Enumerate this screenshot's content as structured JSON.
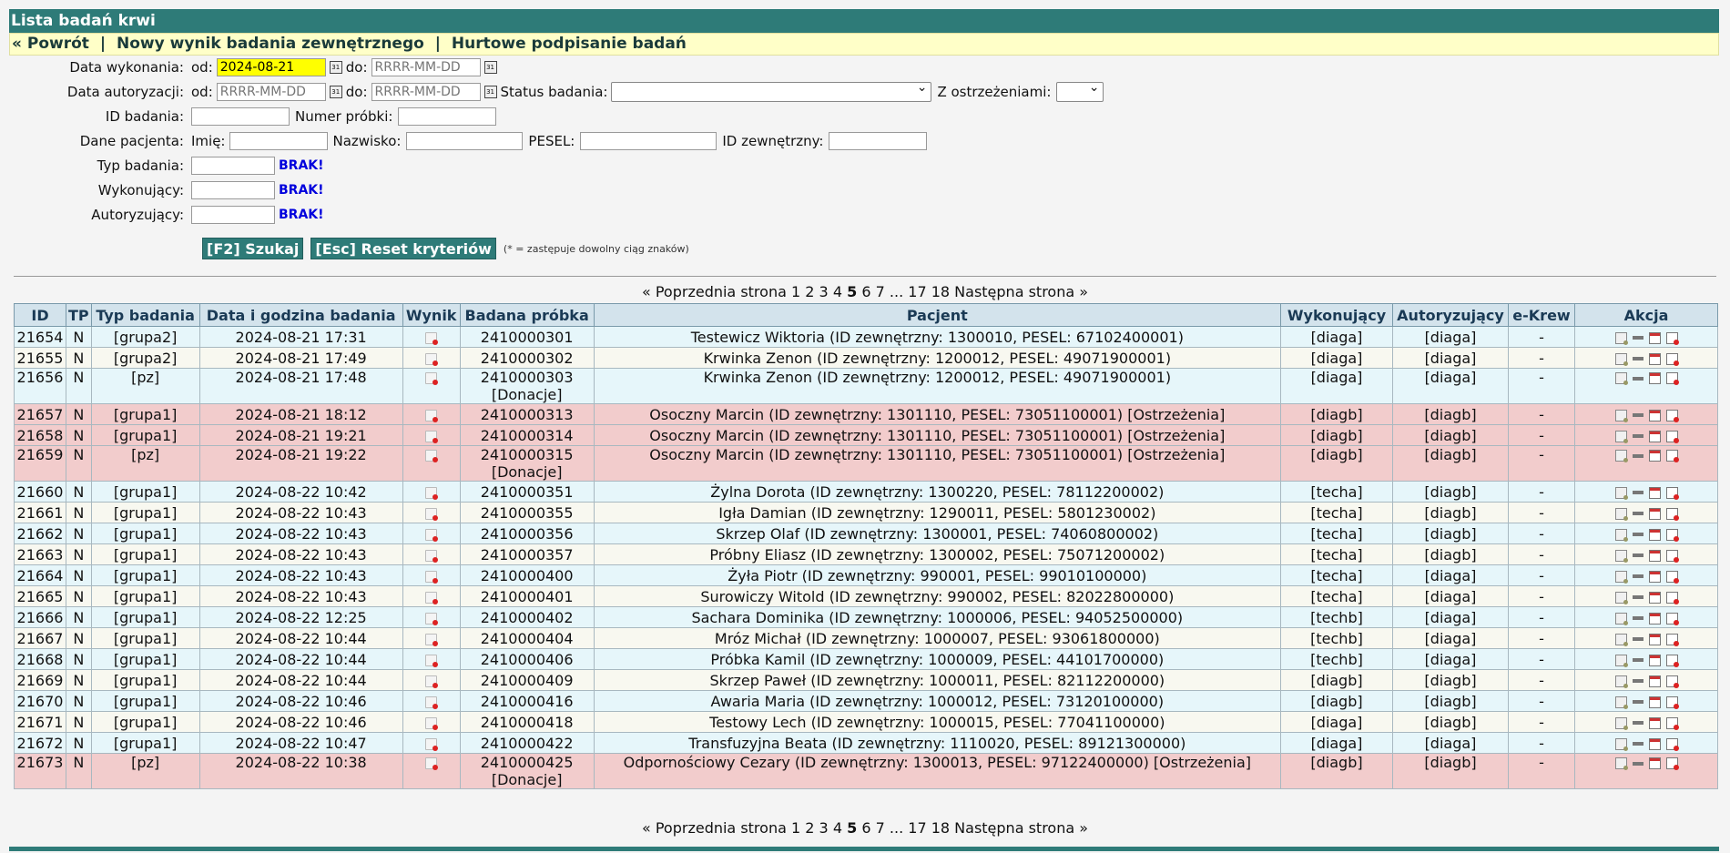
{
  "title": "Lista badań krwi",
  "nav": {
    "back": "« Powrót",
    "new_ext": "Nowy wynik badania zewnętrznego",
    "bulk_sign": "Hurtowe podpisanie badań",
    "sep": "|"
  },
  "form": {
    "date_exec_label": "Data wykonania:",
    "date_auth_label": "Data autoryzacji:",
    "od": "od:",
    "do": "do:",
    "date_exec_from": "2024-08-21",
    "date_placeholder": "RRRR-MM-DD",
    "status_label": "Status badania:",
    "warn_label": "Z ostrzeżeniami:",
    "id_label": "ID badania:",
    "sample_label": "Numer próbki:",
    "patient_label": "Dane pacjenta:",
    "first_name_label": "Imię:",
    "last_name_label": "Nazwisko:",
    "pesel_label": "PESEL:",
    "ext_id_label": "ID zewnętrzny:",
    "type_label": "Typ badania:",
    "performer_label": "Wykonujący:",
    "authorizer_label": "Autoryzujący:",
    "brak": "BRAK!",
    "search_btn": "[F2] Szukaj",
    "reset_btn": "[Esc] Reset kryteriów",
    "note": "(* = zastępuje dowolny ciąg znaków)"
  },
  "pager": {
    "prev": "« Poprzednia strona",
    "pages": [
      "1",
      "2",
      "3",
      "4"
    ],
    "current": "5",
    "after": [
      "6",
      "7"
    ],
    "ellipsis": "...",
    "last": [
      "17",
      "18"
    ],
    "next": "Następna strona »"
  },
  "table": {
    "headers": [
      "ID",
      "TP",
      "Typ badania",
      "Data i godzina badania",
      "Wynik",
      "Badana próbka",
      "Pacjent",
      "Wykonujący",
      "Autoryzujący",
      "e-Krew",
      "Akcja"
    ],
    "rows": [
      {
        "id": "21654",
        "tp": "N",
        "type": "[grupa2]",
        "date": "2024-08-21 17:31",
        "sample": "2410000301",
        "sample2": "",
        "patient": "Testewicz Wiktoria (ID zewnętrzny: 1300010, PESEL: 67102400001)",
        "perf": "[diaga]",
        "auth": "[diaga]",
        "ekrew": "-",
        "style": "c1"
      },
      {
        "id": "21655",
        "tp": "N",
        "type": "[grupa2]",
        "date": "2024-08-21 17:49",
        "sample": "2410000302",
        "sample2": "",
        "patient": "Krwinka Zenon (ID zewnętrzny: 1200012, PESEL: 49071900001)",
        "perf": "[diaga]",
        "auth": "[diaga]",
        "ekrew": "-",
        "style": "c2"
      },
      {
        "id": "21656",
        "tp": "N",
        "type": "[pz]",
        "date": "2024-08-21 17:48",
        "sample": "2410000303",
        "sample2": "[Donacje]",
        "patient": "Krwinka Zenon (ID zewnętrzny: 1200012, PESEL: 49071900001)",
        "perf": "[diaga]",
        "auth": "[diaga]",
        "ekrew": "-",
        "style": "c1"
      },
      {
        "id": "21657",
        "tp": "N",
        "type": "[grupa1]",
        "date": "2024-08-21 18:12",
        "sample": "2410000313",
        "sample2": "",
        "patient": "Osoczny Marcin (ID zewnętrzny: 1301110, PESEL: 73051100001) [Ostrzeżenia]",
        "perf": "[diagb]",
        "auth": "[diagb]",
        "ekrew": "-",
        "style": "w"
      },
      {
        "id": "21658",
        "tp": "N",
        "type": "[grupa1]",
        "date": "2024-08-21 19:21",
        "sample": "2410000314",
        "sample2": "",
        "patient": "Osoczny Marcin (ID zewnętrzny: 1301110, PESEL: 73051100001) [Ostrzeżenia]",
        "perf": "[diagb]",
        "auth": "[diagb]",
        "ekrew": "-",
        "style": "w"
      },
      {
        "id": "21659",
        "tp": "N",
        "type": "[pz]",
        "date": "2024-08-21 19:22",
        "sample": "2410000315",
        "sample2": "[Donacje]",
        "patient": "Osoczny Marcin (ID zewnętrzny: 1301110, PESEL: 73051100001) [Ostrzeżenia]",
        "perf": "[diagb]",
        "auth": "[diagb]",
        "ekrew": "-",
        "style": "w"
      },
      {
        "id": "21660",
        "tp": "N",
        "type": "[grupa1]",
        "date": "2024-08-22 10:42",
        "sample": "2410000351",
        "sample2": "",
        "patient": "Żylna Dorota (ID zewnętrzny: 1300220, PESEL: 78112200002)",
        "perf": "[techa]",
        "auth": "[diagb]",
        "ekrew": "-",
        "style": "c1"
      },
      {
        "id": "21661",
        "tp": "N",
        "type": "[grupa1]",
        "date": "2024-08-22 10:43",
        "sample": "2410000355",
        "sample2": "",
        "patient": "Igła Damian (ID zewnętrzny: 1290011, PESEL: 5801230002)",
        "perf": "[techa]",
        "auth": "[diagb]",
        "ekrew": "-",
        "style": "c2"
      },
      {
        "id": "21662",
        "tp": "N",
        "type": "[grupa1]",
        "date": "2024-08-22 10:43",
        "sample": "2410000356",
        "sample2": "",
        "patient": "Skrzep Olaf (ID zewnętrzny: 1300001, PESEL: 74060800002)",
        "perf": "[techa]",
        "auth": "[diagb]",
        "ekrew": "-",
        "style": "c1"
      },
      {
        "id": "21663",
        "tp": "N",
        "type": "[grupa1]",
        "date": "2024-08-22 10:43",
        "sample": "2410000357",
        "sample2": "",
        "patient": "Próbny Eliasz (ID zewnętrzny: 1300002, PESEL: 75071200002)",
        "perf": "[techa]",
        "auth": "[diagb]",
        "ekrew": "-",
        "style": "c2"
      },
      {
        "id": "21664",
        "tp": "N",
        "type": "[grupa1]",
        "date": "2024-08-22 10:43",
        "sample": "2410000400",
        "sample2": "",
        "patient": "Żyła Piotr (ID zewnętrzny: 990001, PESEL: 99010100000)",
        "perf": "[techa]",
        "auth": "[diaga]",
        "ekrew": "-",
        "style": "c1"
      },
      {
        "id": "21665",
        "tp": "N",
        "type": "[grupa1]",
        "date": "2024-08-22 10:43",
        "sample": "2410000401",
        "sample2": "",
        "patient": "Surowiczy Witold (ID zewnętrzny: 990002, PESEL: 82022800000)",
        "perf": "[techa]",
        "auth": "[diaga]",
        "ekrew": "-",
        "style": "c2"
      },
      {
        "id": "21666",
        "tp": "N",
        "type": "[grupa1]",
        "date": "2024-08-22 12:25",
        "sample": "2410000402",
        "sample2": "",
        "patient": "Sachara Dominika (ID zewnętrzny: 1000006, PESEL: 94052500000)",
        "perf": "[techb]",
        "auth": "[diaga]",
        "ekrew": "-",
        "style": "c1"
      },
      {
        "id": "21667",
        "tp": "N",
        "type": "[grupa1]",
        "date": "2024-08-22 10:44",
        "sample": "2410000404",
        "sample2": "",
        "patient": "Mróz Michał (ID zewnętrzny: 1000007, PESEL: 93061800000)",
        "perf": "[techb]",
        "auth": "[diaga]",
        "ekrew": "-",
        "style": "c2"
      },
      {
        "id": "21668",
        "tp": "N",
        "type": "[grupa1]",
        "date": "2024-08-22 10:44",
        "sample": "2410000406",
        "sample2": "",
        "patient": "Próbka Kamil (ID zewnętrzny: 1000009, PESEL: 44101700000)",
        "perf": "[techb]",
        "auth": "[diaga]",
        "ekrew": "-",
        "style": "c1"
      },
      {
        "id": "21669",
        "tp": "N",
        "type": "[grupa1]",
        "date": "2024-08-22 10:44",
        "sample": "2410000409",
        "sample2": "",
        "patient": "Skrzep Paweł (ID zewnętrzny: 1000011, PESEL: 82112200000)",
        "perf": "[diagb]",
        "auth": "[diagb]",
        "ekrew": "-",
        "style": "c2"
      },
      {
        "id": "21670",
        "tp": "N",
        "type": "[grupa1]",
        "date": "2024-08-22 10:46",
        "sample": "2410000416",
        "sample2": "",
        "patient": "Awaria Maria (ID zewnętrzny: 1000012, PESEL: 73120100000)",
        "perf": "[diagb]",
        "auth": "[diagb]",
        "ekrew": "-",
        "style": "c1"
      },
      {
        "id": "21671",
        "tp": "N",
        "type": "[grupa1]",
        "date": "2024-08-22 10:46",
        "sample": "2410000418",
        "sample2": "",
        "patient": "Testowy Lech (ID zewnętrzny: 1000015, PESEL: 77041100000)",
        "perf": "[diaga]",
        "auth": "[diagb]",
        "ekrew": "-",
        "style": "c2"
      },
      {
        "id": "21672",
        "tp": "N",
        "type": "[grupa1]",
        "date": "2024-08-22 10:47",
        "sample": "2410000422",
        "sample2": "",
        "patient": "Transfuzyjna Beata (ID zewnętrzny: 1110020, PESEL: 89121300000)",
        "perf": "[diaga]",
        "auth": "[diaga]",
        "ekrew": "-",
        "style": "c1"
      },
      {
        "id": "21673",
        "tp": "N",
        "type": "[pz]",
        "date": "2024-08-22 10:38",
        "sample": "2410000425",
        "sample2": "[Donacje]",
        "patient": "Odpornościowy Cezary (ID zewnętrzny: 1300013, PESEL: 97122400000) [Ostrzeżenia]",
        "perf": "[diagb]",
        "auth": "[diagb]",
        "ekrew": "-",
        "style": "w"
      }
    ]
  }
}
